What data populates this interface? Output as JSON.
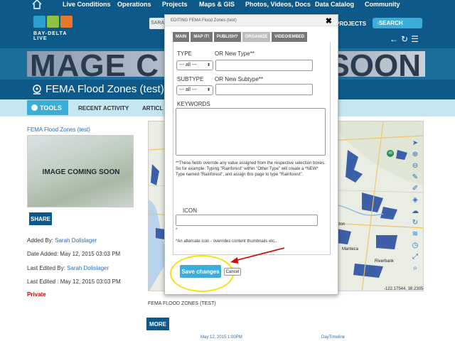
{
  "topnav": {
    "items": [
      "Live Conditions",
      "Operations",
      "Projects",
      "Maps & GIS",
      "Photos, Videos, Docs",
      "Data Catalog",
      "Community"
    ]
  },
  "header": {
    "logo_text": "BAY-DELTA LIVE",
    "search_left_text": "SARA",
    "projects_label": "PROJECTS",
    "search_label": "SEARCH",
    "icons": [
      "back-arrow-icon",
      "refresh-icon",
      "list-icon"
    ],
    "brand_colors": {
      "nav": "#0d5a8a",
      "accent": "#3aaed8"
    }
  },
  "banner": {
    "text_left": "MAGE C",
    "text_right": "SOON"
  },
  "page": {
    "title": "FEMA Flood Zones (test)",
    "tools_label": "TOOLS",
    "tabs": [
      "RECENT ACTIVITY",
      "ARTICL"
    ]
  },
  "left": {
    "breadcrumb": "FEMA Flood Zones (test)",
    "thumb_text": "IMAGE COMING SOON",
    "share_label": "SHARE",
    "added_by_label": "Added By: ",
    "added_by_user": "Sarah Dolislager",
    "date_added": "Date Added: May 12, 2015 03:03 PM",
    "last_edited_by_label": "Last Edited By: ",
    "last_edited_by_user": "Sarah Dolislager",
    "last_edited": "Last Edited : May 12, 2015 03:03 PM",
    "privacy": "Private"
  },
  "map": {
    "caption": "FEMA FLOOD ZONES (TEST)",
    "more_label": "MORE",
    "coords": "-122.17544, 38.2305",
    "labels": [
      "ckton",
      "Manteca",
      "Riverbank"
    ],
    "road_badge": "49",
    "bottom_date": "May 12, 2015 1:00PM",
    "bottom_link": "DayTimeline"
  },
  "modal": {
    "title": "EDITING FEMA Flood Zones (test)",
    "close": "✖",
    "tabs": [
      "MAIN",
      "MAP IT!",
      "PUBLISH?",
      "ORGANIZE",
      "VIDEO/EMBED"
    ],
    "active_tab": "ORGANIZE",
    "type_label": "TYPE",
    "new_type_label": "OR New Type**",
    "type_select": "--- all ---",
    "subtype_label": "SUBTYPE",
    "new_subtype_label": "OR New Subtype**",
    "subtype_select": "--- all ---",
    "keywords_label": "KEYWORDS",
    "note_1": "**These fields override any value assigned from the respective selection boxes.",
    "note_2": "So for example: Typing \"Rainforest\" within \"Other Type\" will create a *NEW* Type named \"Rainforest\", and assign this page to type \"Rainforest\".",
    "icon_label": "ICON",
    "icon_asterisk": "*",
    "icon_note": "*An alternate icon - overrides content thumbnails etc..",
    "save_label": "Save changes",
    "cancel_label": "Cancel"
  }
}
